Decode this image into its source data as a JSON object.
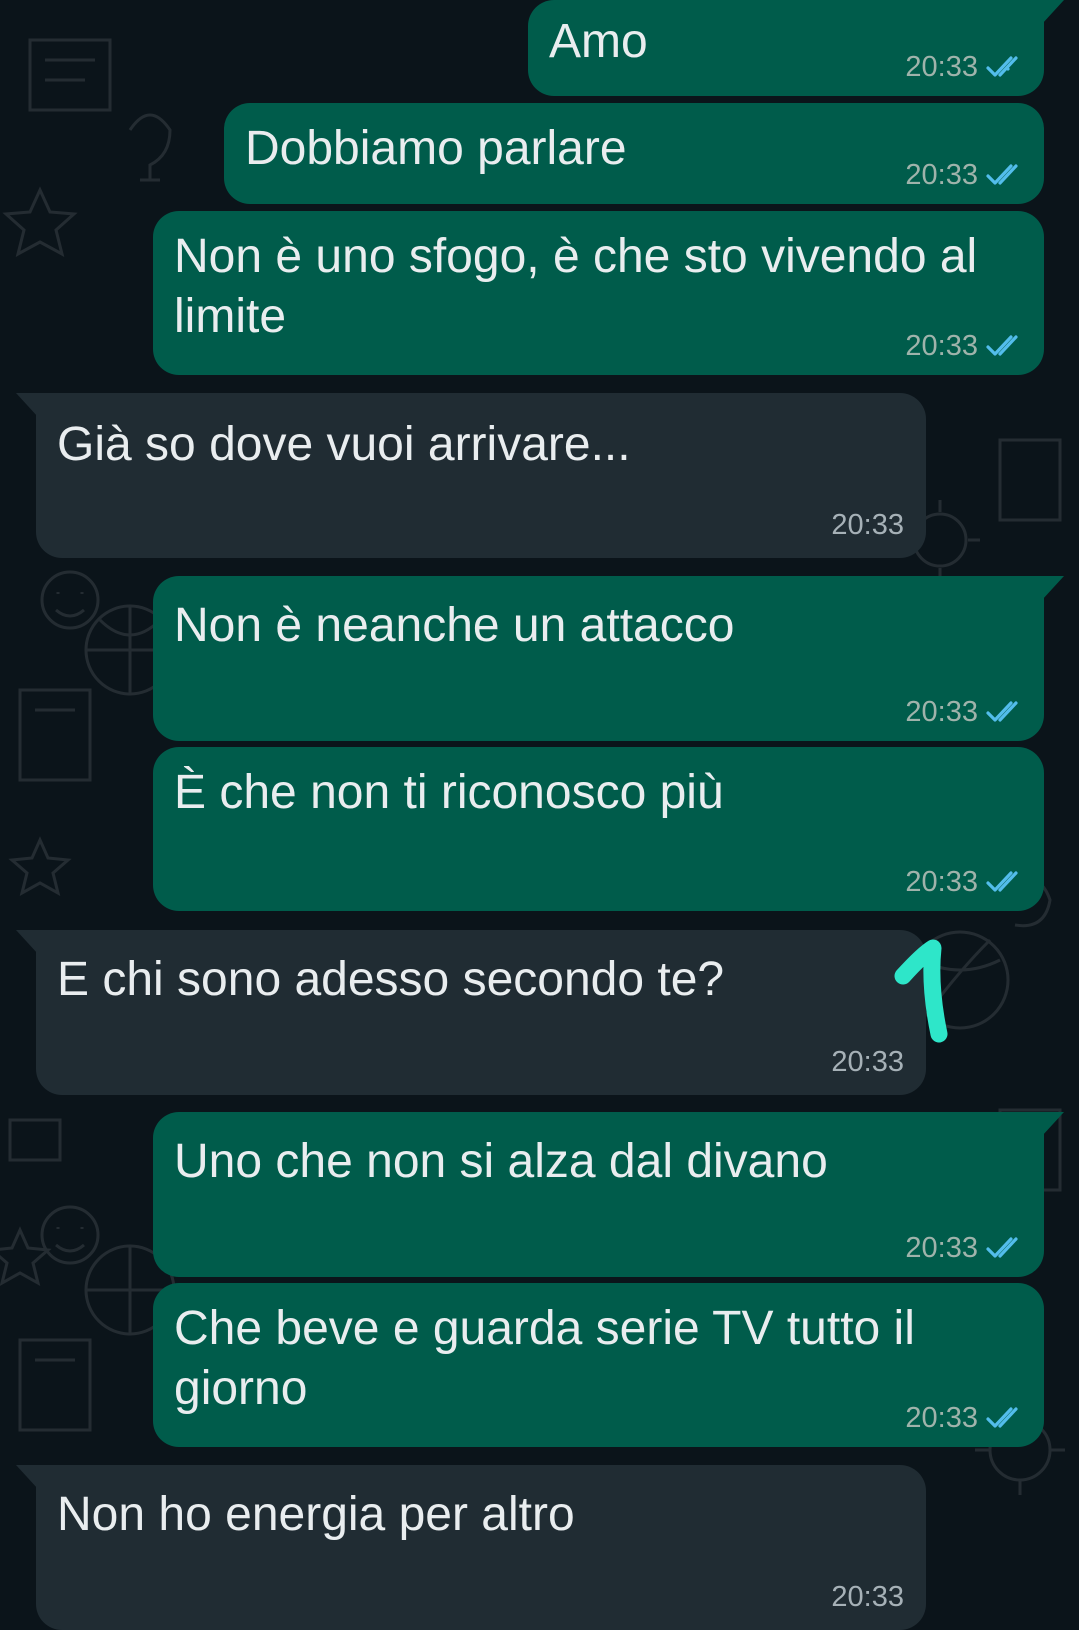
{
  "chat": {
    "messages": [
      {
        "direction": "out",
        "text": "Amo",
        "time": "20:33",
        "status": "read-check-icon"
      },
      {
        "direction": "out",
        "text": "Dobbiamo parlare",
        "time": "20:33",
        "status": "read-check-icon"
      },
      {
        "direction": "out",
        "text": "Non è uno sfogo, è che sto vivendo al limite",
        "time": "20:33",
        "status": "read-check-icon"
      },
      {
        "direction": "in",
        "text": "Già so dove vuoi arrivare...",
        "time": "20:33"
      },
      {
        "direction": "out",
        "text": "Non è neanche un attacco",
        "time": "20:33",
        "status": "read-check-icon"
      },
      {
        "direction": "out",
        "text": "È che non ti riconosco più",
        "time": "20:33",
        "status": "read-check-icon"
      },
      {
        "direction": "in",
        "text": "E chi sono adesso secondo te?",
        "time": "20:33"
      },
      {
        "direction": "out",
        "text": "Uno che non si alza dal divano",
        "time": "20:33",
        "status": "read-check-icon"
      },
      {
        "direction": "out",
        "text": "Che beve e guarda serie TV tutto il giorno",
        "time": "20:33",
        "status": "read-check-icon"
      },
      {
        "direction": "in",
        "text": "Non ho energia per altro",
        "time": "20:33"
      }
    ]
  },
  "annotation": {
    "text": "1",
    "color": "#2ee6c9"
  },
  "colors": {
    "background": "#0b141a",
    "outgoing_bubble": "#005c4b",
    "incoming_bubble": "#202c33",
    "text": "#e9edef",
    "read_check": "#53bdeb"
  }
}
